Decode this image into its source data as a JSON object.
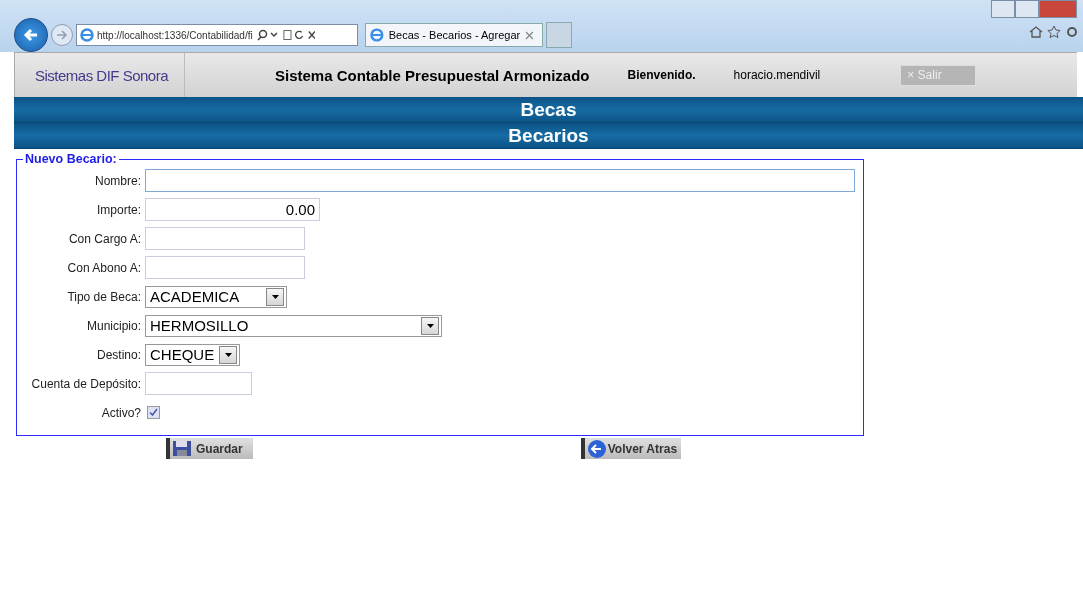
{
  "browser": {
    "address": "http://localhost:1336/Contabilidad/fi",
    "tab_title": "Becas - Becarios - Agregar"
  },
  "header": {
    "brand": "Sistemas DIF Sonora",
    "system_title": "Sistema Contable Presupuestal Armonizado",
    "welcome": "Bienvenido.",
    "user": "horacio.mendivil",
    "logout": "Salir",
    "logout_icon": "×"
  },
  "titles": [
    "Becas",
    "Becarios"
  ],
  "form": {
    "legend": "Nuevo Becario:",
    "fields": [
      {
        "kind": "text",
        "label": "Nombre:",
        "focused": true
      },
      {
        "kind": "text",
        "label": "Importe:",
        "value": "0.00",
        "focused": false
      },
      {
        "kind": "text",
        "label": "Con Cargo A:",
        "focused": false
      },
      {
        "kind": "text",
        "label": "Con Abono A:",
        "focused": false
      },
      {
        "kind": "select",
        "label": "Tipo de Beca:",
        "value": "ACADEMICA"
      },
      {
        "kind": "select",
        "label": "Municipio:",
        "value": "HERMOSILLO"
      },
      {
        "kind": "select",
        "label": "Destino:",
        "value": "CHEQUE"
      },
      {
        "kind": "text",
        "label": "Cuenta de Depósito:",
        "focused": false
      },
      {
        "kind": "checkbox",
        "label": "Activo?",
        "checked": true
      }
    ]
  },
  "buttons": [
    {
      "kind": "save",
      "label": "Guardar"
    },
    {
      "kind": "back",
      "label": "Volver Atras"
    }
  ]
}
